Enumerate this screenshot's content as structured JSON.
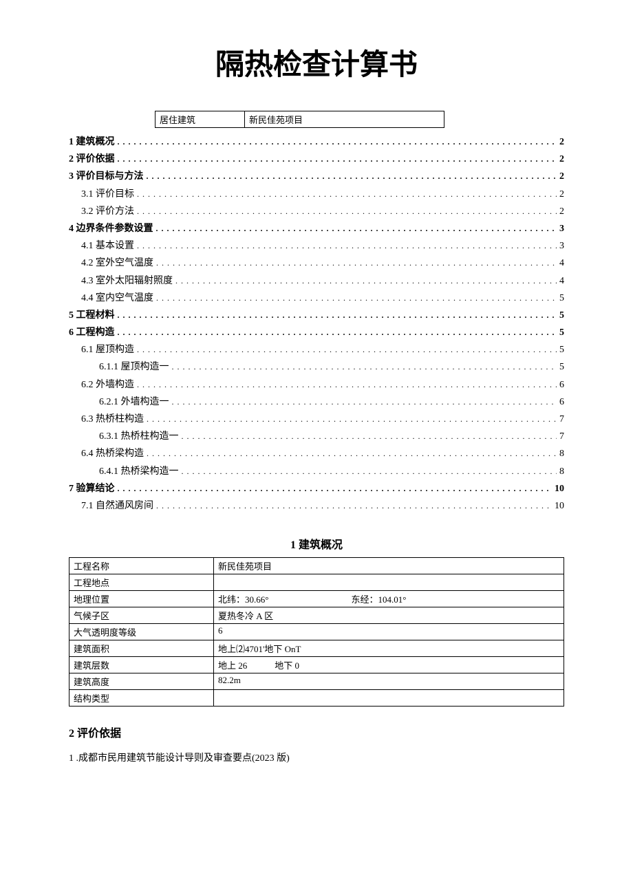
{
  "title": "隔热检查计算书",
  "header": {
    "type_label_line1": "居住建筑",
    "project_name": "新民佳苑项目"
  },
  "toc": [
    {
      "label": "1 建筑概况",
      "page": "2",
      "level": 0,
      "bold": true
    },
    {
      "label": "2 评价依据",
      "page": "2",
      "level": 0,
      "bold": true
    },
    {
      "label": "3 评价目标与方法",
      "page": "2",
      "level": 0,
      "bold": true
    },
    {
      "label": "3.1   评价目标",
      "page": "2",
      "level": 1,
      "bold": false
    },
    {
      "label": "3.2   评价方法",
      "page": "2",
      "level": 1,
      "bold": false
    },
    {
      "label": "4 边界条件参数设置",
      "page": "3",
      "level": 0,
      "bold": true
    },
    {
      "label": "4.1   基本设置",
      "page": "3",
      "level": 1,
      "bold": false
    },
    {
      "label": "4.2   室外空气温度",
      "page": "4",
      "level": 1,
      "bold": false
    },
    {
      "label": "4.3   室外太阳辐射照度",
      "page": "4",
      "level": 1,
      "bold": false
    },
    {
      "label": "4.4   室内空气温度",
      "page": "5",
      "level": 1,
      "bold": false
    },
    {
      "label": "5 工程材料",
      "page": "5",
      "level": 0,
      "bold": true
    },
    {
      "label": "6 工程构造",
      "page": "5",
      "level": 0,
      "bold": true
    },
    {
      "label": "6.1   屋顶构造",
      "page": "5",
      "level": 1,
      "bold": false
    },
    {
      "label": "6.1.1   屋顶构造一",
      "page": "5",
      "level": 2,
      "bold": false
    },
    {
      "label": "6.2   外墙构造",
      "page": "6",
      "level": 1,
      "bold": false
    },
    {
      "label": "6.2.1   外墙构造一",
      "page": "6",
      "level": 2,
      "bold": false
    },
    {
      "label": "6.3   热桥柱构造",
      "page": "7",
      "level": 1,
      "bold": false
    },
    {
      "label": "6.3.1   热桥柱构造一",
      "page": "7",
      "level": 2,
      "bold": false
    },
    {
      "label": "6.4   热桥梁构造",
      "page": "8",
      "level": 1,
      "bold": false
    },
    {
      "label": "6.4.1   热桥梁构造一",
      "page": "8",
      "level": 2,
      "bold": false
    },
    {
      "label": "7 验算结论",
      "page": "10",
      "level": 0,
      "bold": true
    },
    {
      "label": "7.1 自然通风房间",
      "page": "10",
      "level": 1,
      "bold": false
    }
  ],
  "section1": {
    "heading": "1 建筑概况",
    "rows": [
      {
        "label": "工程名称",
        "value": "新民佳苑项目"
      },
      {
        "label": "工程地点",
        "value": ""
      },
      {
        "label": "地理位置",
        "lat": "北纬：30.66°",
        "lon": "东经：104.01°",
        "geo": true
      },
      {
        "label": "气候子区",
        "value": "夏热冬冷 A 区"
      },
      {
        "label": "大气透明度等级",
        "value": "6"
      },
      {
        "label": "建筑面积",
        "value": "地上⑵4701'地下 OnT"
      },
      {
        "label": "建筑层数",
        "above": "地上 26",
        "below": "地下 0",
        "floors": true
      },
      {
        "label": "建筑高度",
        "value": "82.2m"
      },
      {
        "label": "结构类型",
        "value": ""
      }
    ]
  },
  "section2": {
    "heading": "2 评价依据",
    "item1": "1 .成都市民用建筑节能设计导则及审查要点(2023 版)"
  }
}
